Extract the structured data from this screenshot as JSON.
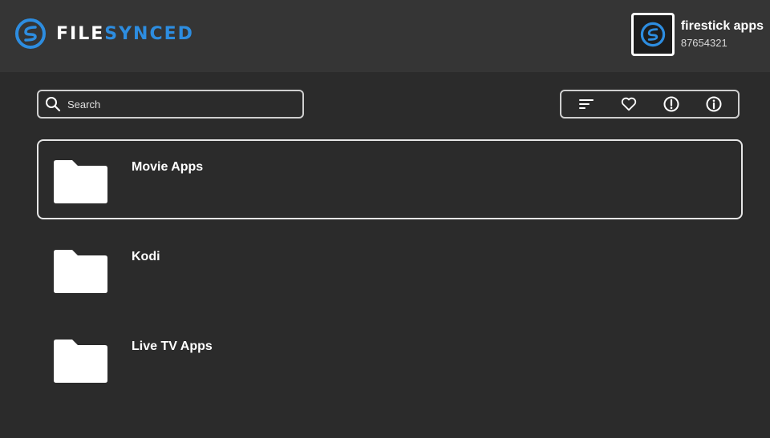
{
  "app": {
    "logo_prefix": "FILE",
    "logo_suffix": "SYNCED",
    "accent_color": "#2d8de0"
  },
  "account": {
    "name": "firestick apps",
    "id": "87654321"
  },
  "search": {
    "placeholder": "Search",
    "value": ""
  },
  "toolbar": {
    "icons": [
      "sort-icon",
      "heart-icon",
      "alert-icon",
      "info-icon"
    ]
  },
  "folders": [
    {
      "label": "Movie Apps",
      "selected": true
    },
    {
      "label": "Kodi",
      "selected": false
    },
    {
      "label": "Live TV Apps",
      "selected": false
    }
  ]
}
